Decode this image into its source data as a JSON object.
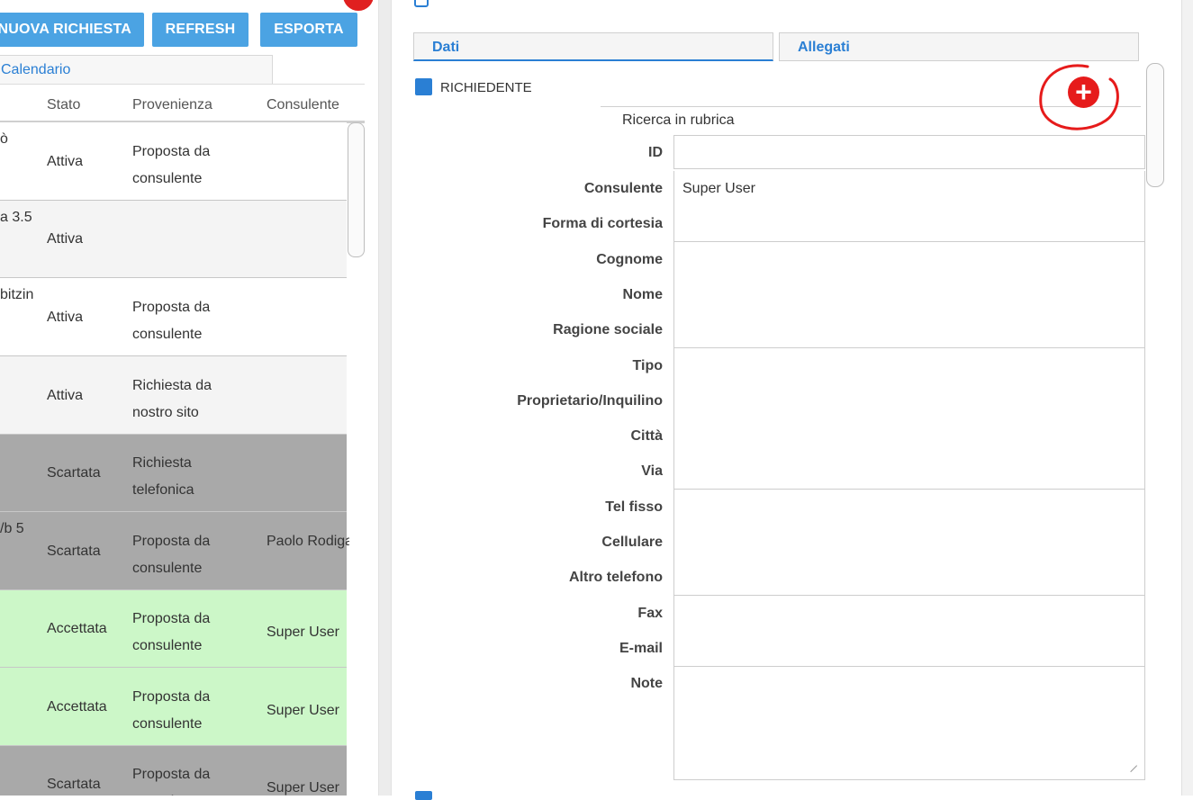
{
  "toolbar": {
    "new_label": "NUOVA RICHIESTA",
    "refresh_label": "REFRESH",
    "export_label": "ESPORTA"
  },
  "left_tab": {
    "label": "Calendario"
  },
  "table": {
    "columns": [
      "Stato",
      "Provenienza",
      "Consulente"
    ],
    "rows": [
      {
        "c0": "ò",
        "stato": "Attiva",
        "prov": "Proposta da consulente",
        "cons": "",
        "bg": "#ffffff"
      },
      {
        "c0": "a 3.5",
        "stato": "Attiva",
        "prov": "",
        "cons": "",
        "bg": "#f4f4f4"
      },
      {
        "c0": "bitzin",
        "stato": "Attiva",
        "prov": "Proposta da consulente",
        "cons": "",
        "bg": "#ffffff"
      },
      {
        "c0": "",
        "stato": "Attiva",
        "prov": "Richiesta da nostro sito",
        "cons": "",
        "bg": "#f4f4f4"
      },
      {
        "c0": "",
        "stato": "Scartata",
        "prov": "Richiesta telefonica",
        "cons": "",
        "bg": "#a9a9a9"
      },
      {
        "c0": "/b 5",
        "stato": "Scartata",
        "prov": "Proposta da consulente",
        "cons": "Paolo Rodigari",
        "bg": "#a9a9a9"
      },
      {
        "c0": "",
        "stato": "Accettata",
        "prov": "Proposta da consulente",
        "cons": "Super User",
        "bg": "#ccf7c8"
      },
      {
        "c0": "",
        "stato": "Accettata",
        "prov": "Proposta da consulente",
        "cons": "Super User",
        "bg": "#ccf7c8"
      },
      {
        "c0": "",
        "stato": "Scartata",
        "prov": "Proposta da consulente",
        "cons": "Super User",
        "bg": "#a9a9a9"
      }
    ]
  },
  "tabs": {
    "dati": "Dati",
    "allegati": "Allegati"
  },
  "section": {
    "title": "RICHIEDENTE",
    "search_label": "Ricerca in rubrica",
    "add_icon": "plus-circle-icon"
  },
  "form": {
    "fields": [
      {
        "label": "ID",
        "value": ""
      },
      {
        "label": "Consulente",
        "value": "Super User"
      },
      {
        "label": "Forma di cortesia",
        "value": ""
      },
      {
        "label": "Cognome",
        "value": ""
      },
      {
        "label": "Nome",
        "value": ""
      },
      {
        "label": "Ragione sociale",
        "value": ""
      },
      {
        "label": "Tipo",
        "value": ""
      },
      {
        "label": "Proprietario/Inquilino",
        "value": ""
      },
      {
        "label": "Città",
        "value": ""
      },
      {
        "label": "Via",
        "value": ""
      },
      {
        "label": "Tel fisso",
        "value": ""
      },
      {
        "label": "Cellulare",
        "value": ""
      },
      {
        "label": "Altro telefono",
        "value": ""
      },
      {
        "label": "Fax",
        "value": ""
      },
      {
        "label": "E-mail",
        "value": ""
      }
    ],
    "note_label": "Note",
    "note_value": ""
  },
  "colors": {
    "accent": "#2a7fd4",
    "button": "#4ba3e3",
    "annotation_red": "#e61b1b"
  }
}
